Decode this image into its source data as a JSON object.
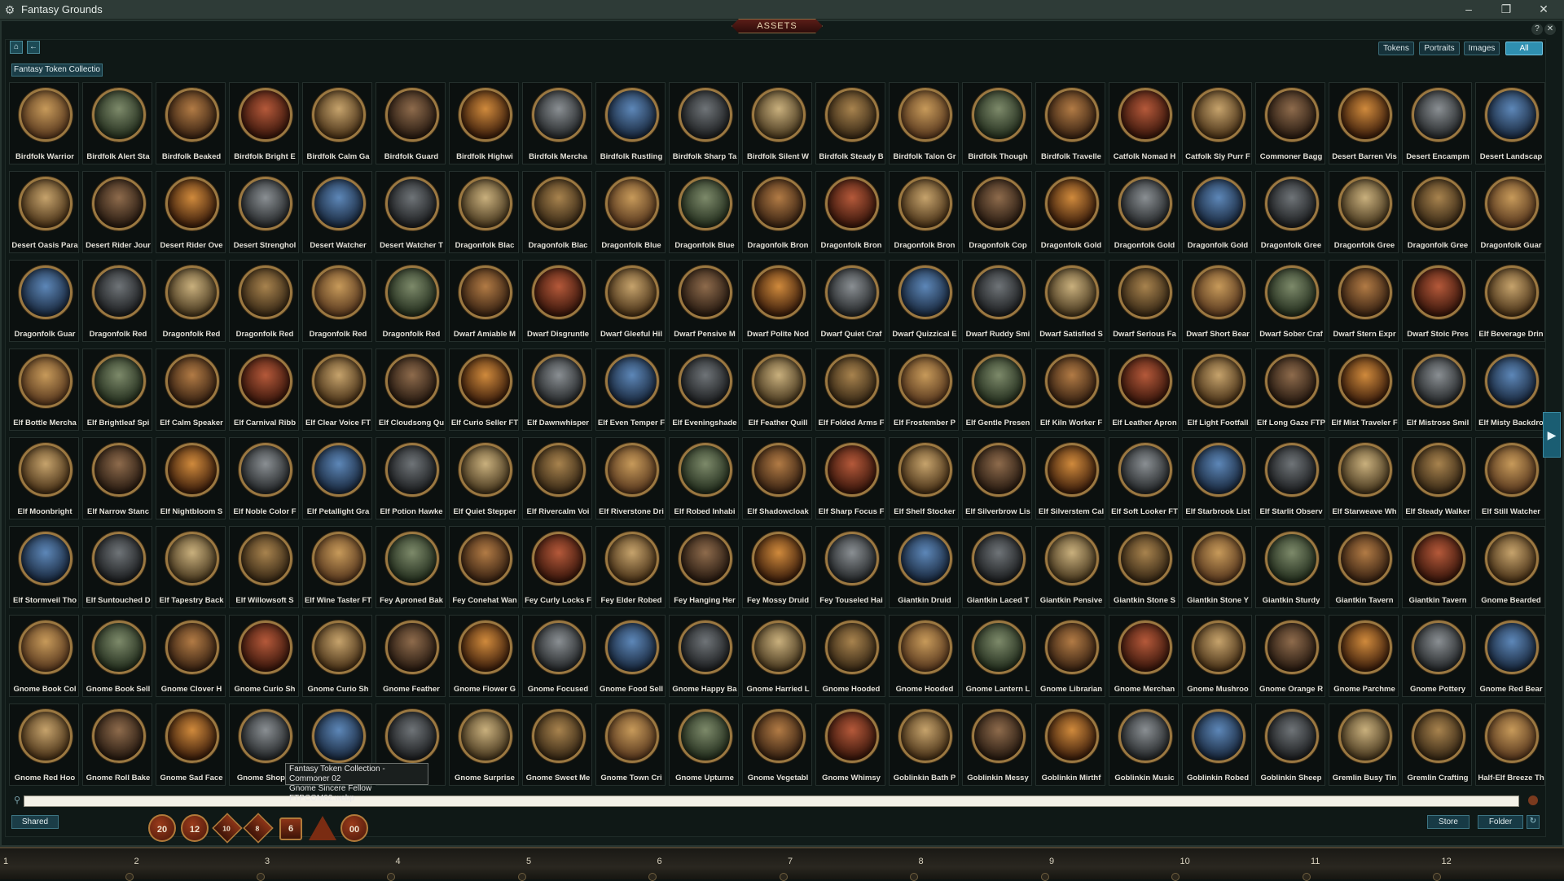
{
  "window": {
    "title": "Fantasy Grounds",
    "controls": [
      "–",
      "❐",
      "✕"
    ]
  },
  "panel": {
    "tab_title": "ASSETS",
    "nav": {
      "home_glyph": "⌂",
      "back_glyph": "←"
    },
    "filters": [
      {
        "label": "Tokens",
        "active": false
      },
      {
        "label": "Portraits",
        "active": false
      },
      {
        "label": "Images",
        "active": false
      },
      {
        "label": "All",
        "active": true
      }
    ],
    "corner_controls": [
      "?",
      "✕"
    ],
    "breadcrumb": "Fantasy Token Collectio"
  },
  "tiles": [
    "Birdfolk Warrior",
    "Birdfolk Alert Sta",
    "Birdfolk Beaked",
    "Birdfolk Bright E",
    "Birdfolk Calm Ga",
    "Birdfolk Guard",
    "Birdfolk Highwi",
    "Birdfolk Mercha",
    "Birdfolk Rustling",
    "Birdfolk Sharp Ta",
    "Birdfolk Silent W",
    "Birdfolk Steady B",
    "Birdfolk Talon Gr",
    "Birdfolk Though",
    "Birdfolk Travelle",
    "Catfolk Nomad H",
    "Catfolk Sly Purr F",
    "Commoner Bagg",
    "Desert Barren Vis",
    "Desert Encampm",
    "Desert Landscap",
    "Desert Oasis Para",
    "Desert Rider Jour",
    "Desert Rider Ove",
    "Desert Strenghol",
    "Desert Watcher",
    "Desert Watcher T",
    "Dragonfolk Blac",
    "Dragonfolk Blac",
    "Dragonfolk Blue",
    "Dragonfolk Blue",
    "Dragonfolk Bron",
    "Dragonfolk Bron",
    "Dragonfolk Bron",
    "Dragonfolk Cop",
    "Dragonfolk Gold",
    "Dragonfolk Gold",
    "Dragonfolk Gold",
    "Dragonfolk Gree",
    "Dragonfolk Gree",
    "Dragonfolk Gree",
    "Dragonfolk Guar",
    "Dragonfolk Guar",
    "Dragonfolk Red",
    "Dragonfolk Red",
    "Dragonfolk Red",
    "Dragonfolk Red",
    "Dragonfolk Red",
    "Dwarf Amiable M",
    "Dwarf Disgruntle",
    "Dwarf Gleeful Hil",
    "Dwarf Pensive M",
    "Dwarf Polite Nod",
    "Dwarf Quiet Craf",
    "Dwarf Quizzical E",
    "Dwarf Ruddy Smi",
    "Dwarf Satisfied S",
    "Dwarf Serious Fa",
    "Dwarf Short Bear",
    "Dwarf Sober Craf",
    "Dwarf Stern Expr",
    "Dwarf Stoic Pres",
    "Elf Beverage Drin",
    "Elf Bottle Mercha",
    "Elf Brightleaf Spi",
    "Elf Calm Speaker",
    "Elf Carnival Ribb",
    "Elf Clear Voice FT",
    "Elf Cloudsong Qu",
    "Elf Curio Seller FT",
    "Elf Dawnwhisper",
    "Elf Even Temper F",
    "Elf Eveningshade",
    "Elf Feather Quill",
    "Elf Folded Arms F",
    "Elf Frostember P",
    "Elf Gentle Presen",
    "Elf Kiln Worker F",
    "Elf Leather Apron",
    "Elf Light Footfall",
    "Elf Long Gaze FTP",
    "Elf Mist Traveler F",
    "Elf Mistrose Smil",
    "Elf Misty Backdro",
    "Elf Moonbright",
    "Elf Narrow Stanc",
    "Elf Nightbloom S",
    "Elf Noble Color F",
    "Elf Petallight Gra",
    "Elf Potion Hawke",
    "Elf Quiet Stepper",
    "Elf Rivercalm Voi",
    "Elf Riverstone Dri",
    "Elf Robed Inhabi",
    "Elf Shadowcloak",
    "Elf Sharp Focus F",
    "Elf Shelf Stocker",
    "Elf Silverbrow Lis",
    "Elf Silverstem Cal",
    "Elf Soft Looker FT",
    "Elf Starbrook List",
    "Elf Starlit Observ",
    "Elf Starweave Wh",
    "Elf Steady Walker",
    "Elf Still Watcher",
    "Elf Stormveil Tho",
    "Elf Suntouched D",
    "Elf Tapestry Back",
    "Elf Willowsoft S",
    "Elf Wine Taster FT",
    "Fey Aproned Bak",
    "Fey Conehat Wan",
    "Fey Curly Locks F",
    "Fey Elder Robed",
    "Fey Hanging Her",
    "Fey Mossy Druid",
    "Fey Touseled Hai",
    "Giantkin Druid",
    "Giantkin Laced T",
    "Giantkin Pensive",
    "Giantkin Stone S",
    "Giantkin Stone Y",
    "Giantkin Sturdy",
    "Giantkin Tavern",
    "Giantkin Tavern",
    "Gnome Bearded",
    "Gnome Book Col",
    "Gnome Book Sell",
    "Gnome Clover H",
    "Gnome Curio Sh",
    "Gnome Curio Sh",
    "Gnome Feather",
    "Gnome Flower G",
    "Gnome Focused",
    "Gnome Food Sell",
    "Gnome Happy Ba",
    "Gnome Harried L",
    "Gnome Hooded",
    "Gnome Hooded",
    "Gnome Lantern L",
    "Gnome Librarian",
    "Gnome Merchan",
    "Gnome Mushroo",
    "Gnome Orange R",
    "Gnome Parchme",
    "Gnome Pottery",
    "Gnome Red Bear",
    "Gnome Red Hoo",
    "Gnome Roll Bake",
    "Gnome Sad Face",
    "Gnome Shop A",
    "",
    "Fr",
    "Gnome Surprise",
    "Gnome Sweet Me",
    "Gnome Town Cri",
    "Gnome Upturne",
    "Gnome Vegetabl",
    "Gnome Whimsy",
    "Goblinkin Bath P",
    "Goblinkin Messy",
    "Goblinkin Mirthf",
    "Goblinkin Music",
    "Goblinkin Robed",
    "Goblinkin Sheep",
    "Gremlin Busy Tin",
    "Gremlin Crafting",
    "Half-Elf Breeze Th"
  ],
  "tooltip": {
    "line1": "Fantasy Token Collection - Commoner 02",
    "line2": "Gnome Sincere Fellow FTPCOM02.webp"
  },
  "bottom": {
    "shared_label": "Shared",
    "store_label": "Store",
    "folder_label": "Folder",
    "refresh_glyph": "↻",
    "dice": [
      "20",
      "12",
      "10",
      "8",
      "6",
      "4",
      "00"
    ]
  },
  "hotbar": {
    "slots": [
      "1",
      "2",
      "3",
      "4",
      "5",
      "6",
      "7",
      "8",
      "9",
      "10",
      "11",
      "12"
    ]
  },
  "colors": {
    "accent": "#2f8fb0",
    "frame_gold": "#9b7841",
    "panel_bg": "#0f1816"
  }
}
